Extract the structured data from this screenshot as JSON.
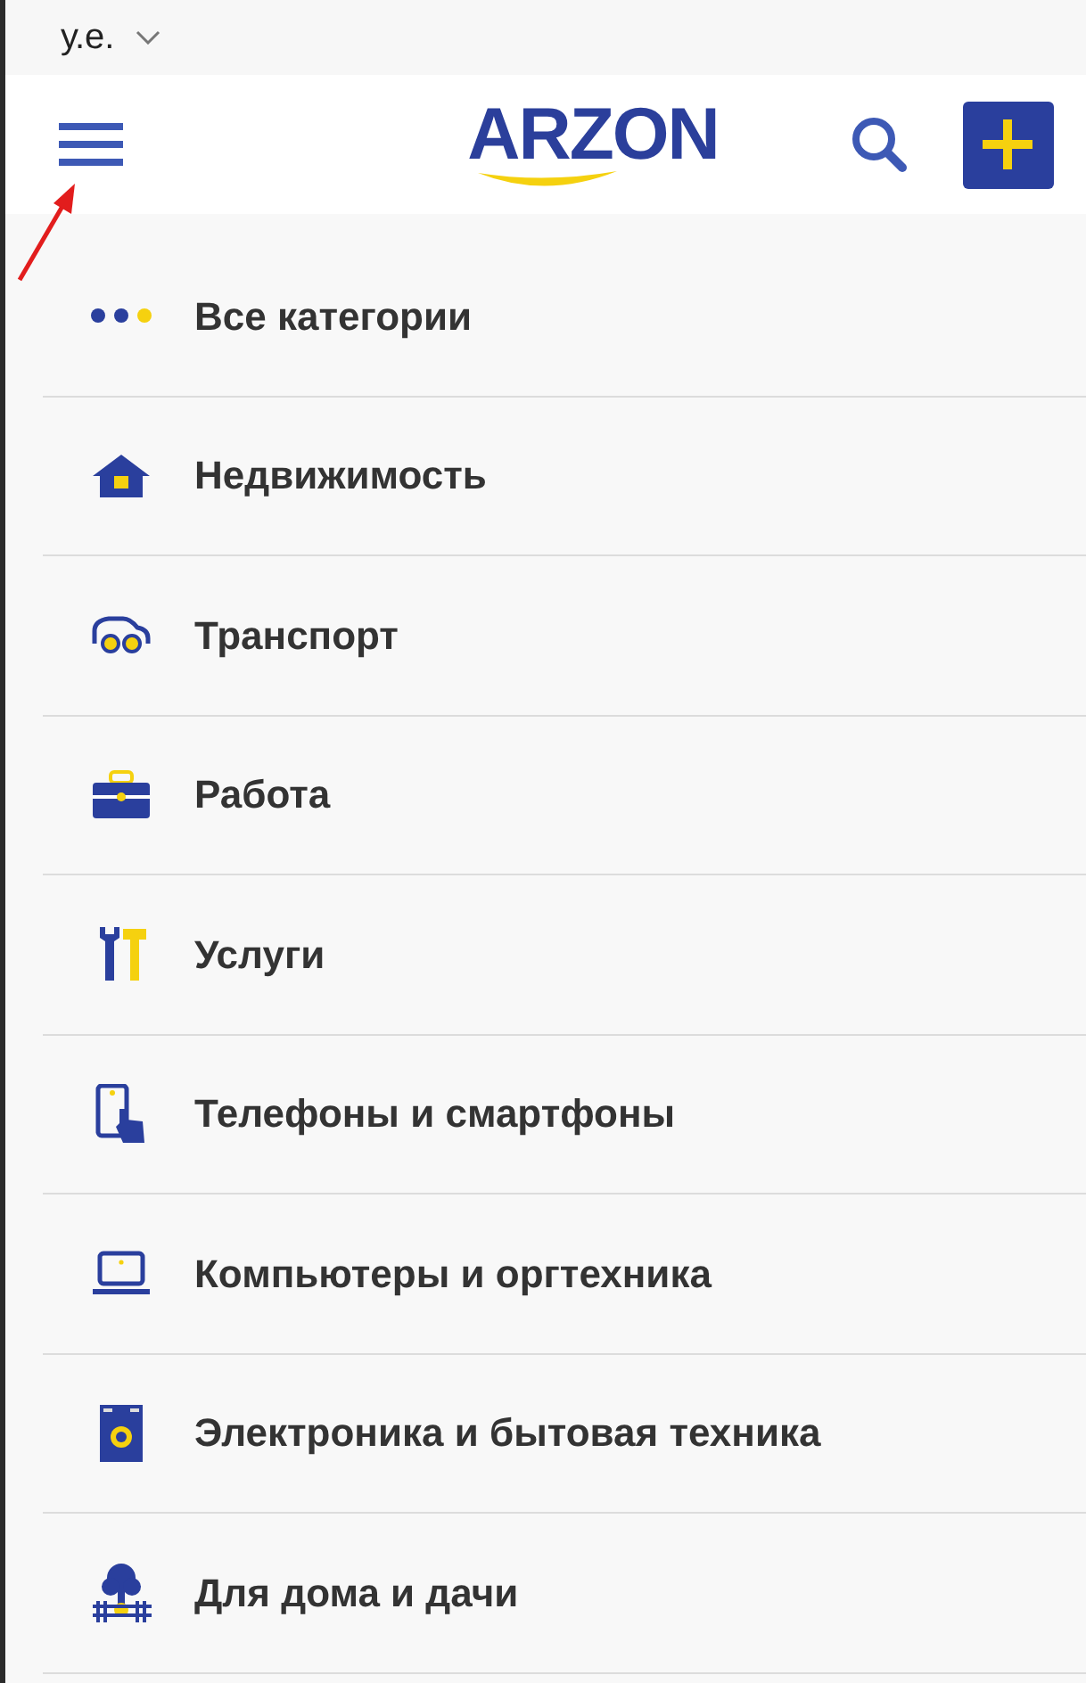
{
  "currency": {
    "label": "у.е."
  },
  "header": {
    "logo": "ARZON"
  },
  "categories": [
    {
      "kind": "all",
      "label": "Все категории"
    },
    {
      "kind": "realty",
      "label": "Недвижимость"
    },
    {
      "kind": "transport",
      "label": "Транспорт"
    },
    {
      "kind": "work",
      "label": "Работа"
    },
    {
      "kind": "services",
      "label": "Услуги"
    },
    {
      "kind": "phones",
      "label": "Телефоны и смартфоны"
    },
    {
      "kind": "computers",
      "label": "Компьютеры и оргтехника"
    },
    {
      "kind": "electronics",
      "label": "Электроника и бытовая техника"
    },
    {
      "kind": "home",
      "label": "Для дома и дачи"
    }
  ]
}
